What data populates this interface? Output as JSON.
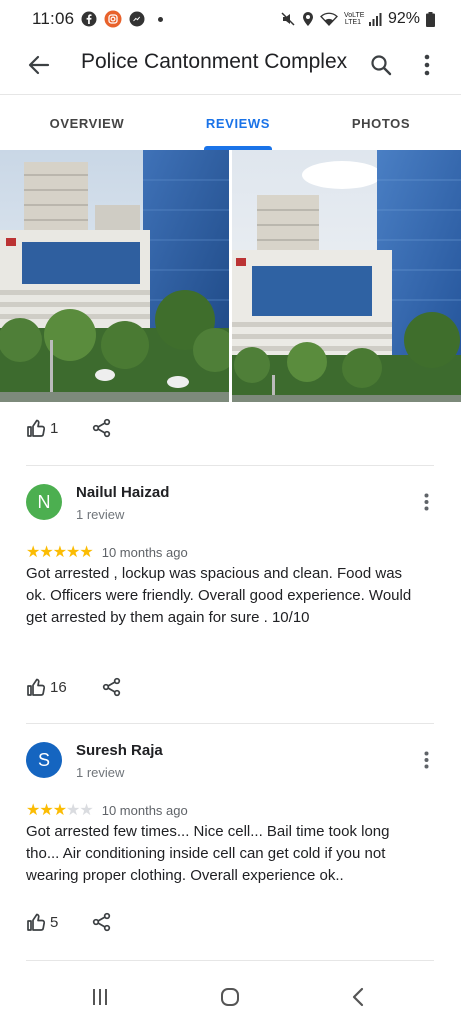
{
  "status_bar": {
    "time": "11:06",
    "battery": "92%",
    "network": "VoLTE",
    "network_sub": "LTE1",
    "icons": [
      "facebook-icon",
      "instagram-icon",
      "messenger-icon",
      "mute-icon",
      "location-icon",
      "wifi-icon",
      "signal-icon",
      "battery-icon"
    ]
  },
  "app_bar": {
    "title": "Police Cantonment Complex",
    "icons": [
      "back-arrow-icon",
      "search-icon",
      "more-vert-icon"
    ]
  },
  "tabs": [
    {
      "label": "OVERVIEW",
      "active": false
    },
    {
      "label": "REVIEWS",
      "active": true
    },
    {
      "label": "PHOTOS",
      "active": false
    }
  ],
  "photo_post": {
    "likes": "1"
  },
  "reviews": [
    {
      "initial": "N",
      "avatar_color": "#4caf50",
      "name": "Nailul Haizad",
      "meta": "1 review",
      "rating": 5,
      "date": "10 months ago",
      "text": "Got arrested  , lockup was spacious and clean. Food was ok. Officers were friendly. Overall good experience.  Would get arrested by them again for sure . 10/10",
      "likes": "16"
    },
    {
      "initial": "S",
      "avatar_color": "#1565c0",
      "name": "Suresh Raja",
      "meta": "1 review",
      "rating": 3,
      "date": "10 months ago",
      "text": "Got arrested few times... Nice cell... Bail time took long tho... Air conditioning inside cell can get cold if you not wearing proper clothing. Overall experience ok..",
      "likes": "5"
    }
  ],
  "colors": {
    "accent": "#1a73e8",
    "star": "#fbbc04"
  },
  "nav_bar": {
    "icons": [
      "recent-apps-icon",
      "home-icon",
      "back-icon"
    ]
  }
}
